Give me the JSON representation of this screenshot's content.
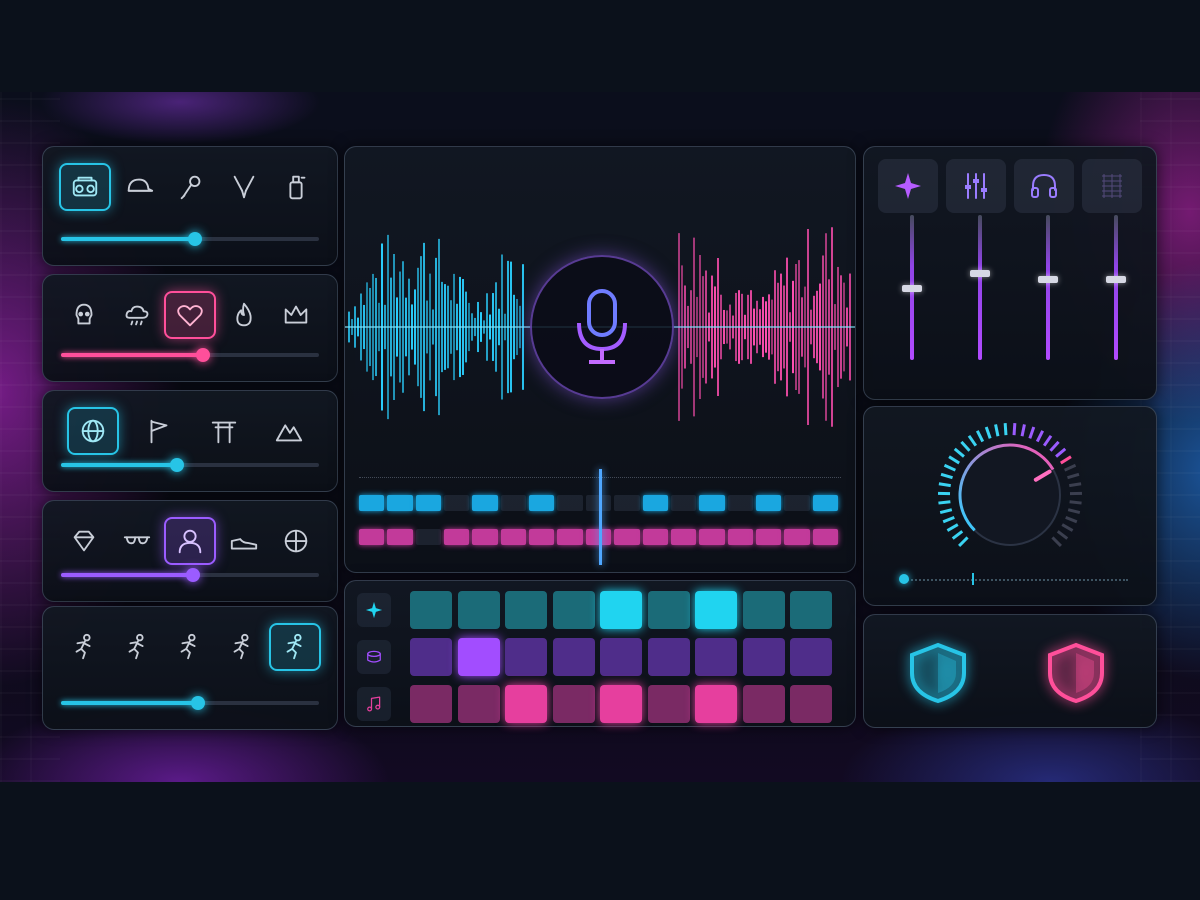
{
  "app": {
    "accent_cyan": "#27c4e6",
    "accent_pink": "#ff4f9a",
    "accent_purple": "#9b5cff",
    "background": "#0b111b"
  },
  "selector_panels": [
    {
      "icons": [
        "boombox-icon",
        "cap-icon",
        "microphone-icon",
        "chain-icon",
        "spray-can-icon"
      ],
      "selected": 0,
      "selected_color": "cyan",
      "slider_value": 0.52,
      "slider_color": "#27c4e6"
    },
    {
      "icons": [
        "skull-icon",
        "cloud-icon",
        "heart-icon",
        "flame-icon",
        "crown-icon"
      ],
      "selected": 2,
      "selected_color": "pink",
      "slider_value": 0.55,
      "slider_color": "#ff4f9a"
    },
    {
      "icons": [
        "globe-icon",
        "flag-icon",
        "torii-gate-icon",
        "mountain-icon"
      ],
      "selected": 0,
      "selected_color": "cyan",
      "slider_value": 0.45,
      "slider_color": "#27c4e6"
    },
    {
      "icons": [
        "diamond-icon",
        "sunglasses-icon",
        "avatar-icon",
        "sneaker-icon",
        "basketball-icon"
      ],
      "selected": 2,
      "selected_color": "purple",
      "slider_value": 0.51,
      "slider_color": "#9b5cff"
    },
    {
      "icons": [
        "runner-icon",
        "runner-icon",
        "runner-icon",
        "runner-icon",
        "runner-icon"
      ],
      "selected": 4,
      "selected_color": "cyan",
      "slider_value": 0.53,
      "slider_color": "#27c4e6"
    }
  ],
  "waveform": {
    "center_icon": "microphone-icon",
    "left_color": "#2bd0ff",
    "right_color": "#ff4fb0",
    "playhead_position": 0.5
  },
  "timeline": {
    "track_1_color": "#1aa7e0",
    "track_2_color": "#c23a9a",
    "track_1_active": [
      1,
      1,
      1,
      0,
      1,
      0,
      1,
      0,
      0,
      0,
      1,
      0,
      1,
      0,
      1,
      0,
      1
    ],
    "track_2_active": [
      1,
      1,
      0,
      1,
      1,
      1,
      1,
      1,
      1,
      1,
      1,
      1,
      1,
      1,
      1,
      1,
      1
    ]
  },
  "sequencer": {
    "rows": [
      {
        "icon": "sparkle-icon",
        "color": "#1b6b78",
        "active_color": "#20d4f0",
        "steps": [
          0,
          0,
          0,
          0,
          1,
          0,
          1,
          0,
          0
        ]
      },
      {
        "icon": "drum-icon",
        "color": "#4f2d8a",
        "active_color": "#a24dff",
        "steps": [
          0,
          1,
          0,
          0,
          0,
          0,
          0,
          0,
          0
        ]
      },
      {
        "icon": "music-note-icon",
        "color": "#7a2a64",
        "active_color": "#e63f9e",
        "steps": [
          0,
          0,
          1,
          0,
          1,
          0,
          1,
          0,
          0
        ]
      }
    ]
  },
  "mixer": {
    "tabs": [
      "sparkle-icon",
      "equalizer-icon",
      "headphones-icon",
      "grid-icon"
    ],
    "selected_tab": 0,
    "fader_levels": [
      0.52,
      0.62,
      0.58,
      0.58
    ]
  },
  "knob": {
    "value": 0.72,
    "slider_value": 0.02
  },
  "shields": [
    {
      "icon": "shield-icon",
      "color": "#27c4e6"
    },
    {
      "icon": "shield-icon",
      "color": "#ff4f9a"
    }
  ]
}
